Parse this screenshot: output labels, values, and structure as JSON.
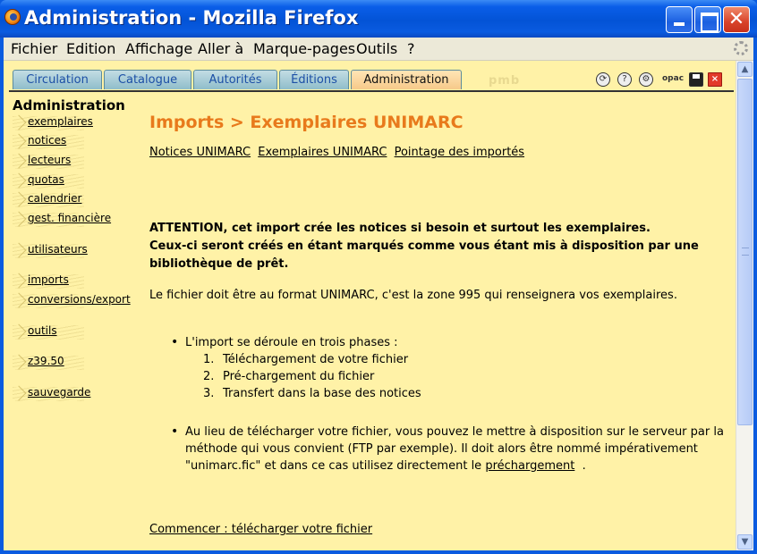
{
  "window": {
    "title": "Administration - Mozilla Firefox"
  },
  "menu": [
    "Fichier",
    "Edition",
    "Affichage",
    "Aller à",
    "Marque-pages",
    "Outils",
    "?"
  ],
  "tabs": [
    {
      "label": "Circulation"
    },
    {
      "label": "Catalogue"
    },
    {
      "label": "Autorités"
    },
    {
      "label": "Éditions"
    },
    {
      "label": "Administration",
      "active": true
    }
  ],
  "logo_text": "pmb",
  "toolbar_icons": [
    "refresh-icon",
    "help-icon",
    "settings-icon",
    "opac-icon",
    "save-icon",
    "close-icon"
  ],
  "toolbar_opac_label": "opac",
  "nav": {
    "title": "Administration",
    "items": [
      "exemplaires",
      "notices",
      "lecteurs",
      "quotas",
      "calendrier",
      "gest. financière",
      "utilisateurs",
      "imports",
      "conversions/export",
      "outils",
      "z39.50",
      "sauvegarde"
    ]
  },
  "main": {
    "title": "Imports > Exemplaires UNIMARC",
    "sub_links": [
      "Notices UNIMARC",
      "Exemplaires UNIMARC",
      "Pointage des importés"
    ],
    "warning_line1": "ATTENTION, cet import crée les notices si besoin et surtout les exemplaires.",
    "warning_line2": "Ceux-ci seront créés en étant marqués comme vous étant mis à disposition par une bibliothèque de prêt.",
    "format_info": "Le fichier doit être au format UNIMARC, c'est la zone 995 qui renseignera vos exemplaires.",
    "phases_intro": "L'import se déroule en trois phases :",
    "phases": [
      "Téléchargement de votre fichier",
      "Pré-chargement du fichier",
      "Transfert dans la base des notices"
    ],
    "alt_text": "Au lieu de télécharger votre fichier, vous pouvez le mettre à disposition sur le serveur par la méthode qui vous convient (FTP par exemple). Il doit alors être nommé impérativement \"unimarc.fic\" et dans ce cas utilisez directement le",
    "alt_link": "préchargement",
    "alt_end": ".",
    "start_link": "Commencer : télécharger votre fichier"
  }
}
